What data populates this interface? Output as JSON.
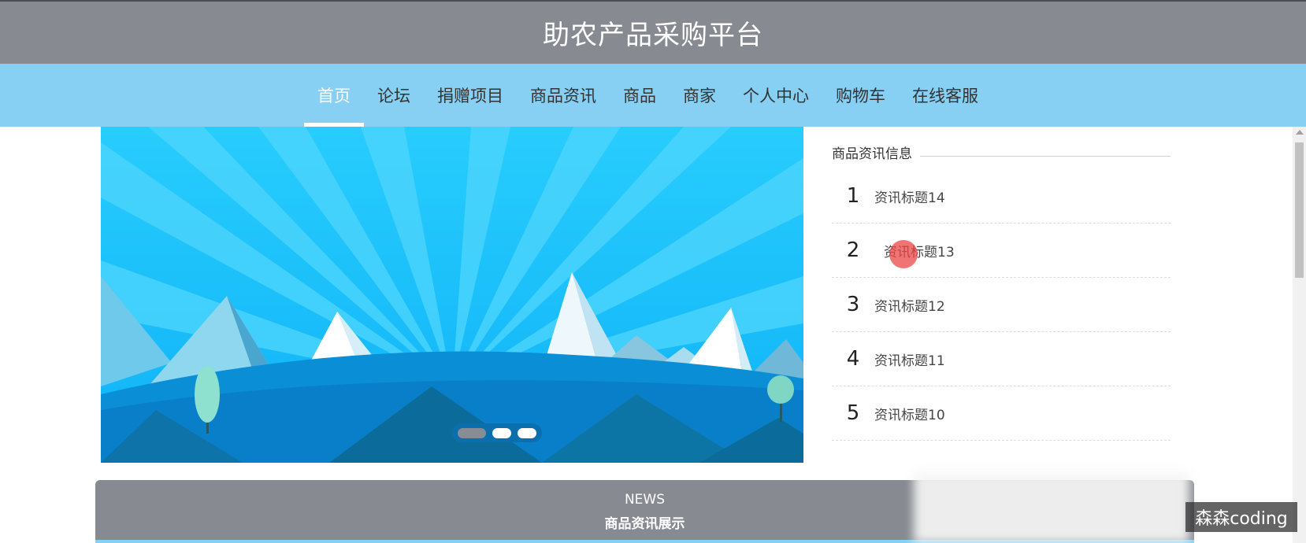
{
  "header": {
    "title": "助农产品采购平台"
  },
  "nav": {
    "items": [
      {
        "label": "首页",
        "active": true
      },
      {
        "label": "论坛"
      },
      {
        "label": "捐赠项目"
      },
      {
        "label": "商品资讯"
      },
      {
        "label": "商品"
      },
      {
        "label": "商家"
      },
      {
        "label": "个人中心"
      },
      {
        "label": "购物车"
      },
      {
        "label": "在线客服"
      }
    ]
  },
  "banner": {
    "slide_count": 3,
    "active_slide": 1
  },
  "sidebar": {
    "title": "商品资讯信息",
    "items": [
      {
        "num": "1",
        "title": "资讯标题14"
      },
      {
        "num": "2",
        "title": "资讯标题13"
      },
      {
        "num": "3",
        "title": "资讯标题12"
      },
      {
        "num": "4",
        "title": "资讯标题11"
      },
      {
        "num": "5",
        "title": "资讯标题10"
      }
    ]
  },
  "news_section": {
    "en": "NEWS",
    "cn": "商品资讯展示"
  },
  "watermark": "森森coding",
  "colors": {
    "header": "#878a91",
    "nav": "#87d0f3",
    "banner_sky": "#18c0fc"
  }
}
